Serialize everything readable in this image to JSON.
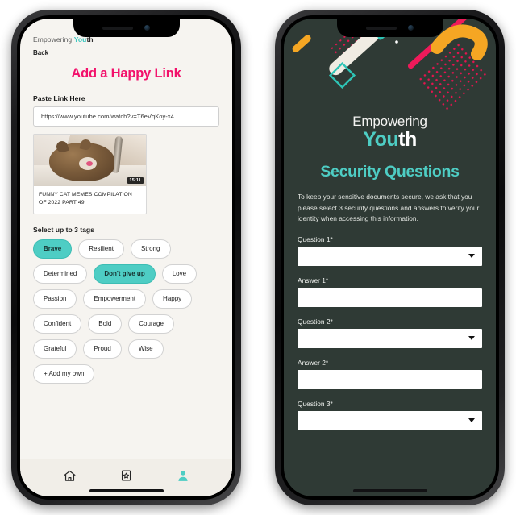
{
  "left_phone": {
    "brand": {
      "prefix": "Empowering ",
      "accent": "You",
      "dark": "th"
    },
    "back_label": "Back",
    "page_title": "Add a Happy Link",
    "link_field": {
      "label": "Paste Link Here",
      "value": "https://www.youtube.com/watch?v=T6eVqKoy-x4"
    },
    "preview": {
      "caption": "FUNNY CAT MEMES COMPILATION OF 2022 PART 49",
      "duration": "15:11"
    },
    "tags_label": "Select up to 3 tags",
    "tag_rows": [
      [
        {
          "label": "Brave",
          "selected": true
        },
        {
          "label": "Resilient",
          "selected": false
        },
        {
          "label": "Strong",
          "selected": false
        }
      ],
      [
        {
          "label": "Determined",
          "selected": false
        },
        {
          "label": "Don't give up",
          "selected": true
        },
        {
          "label": "Love",
          "selected": false
        }
      ],
      [
        {
          "label": "Passion",
          "selected": false
        },
        {
          "label": "Empowerment",
          "selected": false
        },
        {
          "label": "Happy",
          "selected": false
        }
      ],
      [
        {
          "label": "Confident",
          "selected": false
        },
        {
          "label": "Bold",
          "selected": false
        },
        {
          "label": "Courage",
          "selected": false
        }
      ],
      [
        {
          "label": "Grateful",
          "selected": false
        },
        {
          "label": "Proud",
          "selected": false
        },
        {
          "label": "Wise",
          "selected": false
        }
      ],
      [
        {
          "label": "+ Add my own",
          "selected": false
        }
      ]
    ],
    "tabbar": [
      {
        "icon": "home-icon",
        "active": false
      },
      {
        "icon": "star-box-icon",
        "active": false
      },
      {
        "icon": "profile-icon",
        "active": true
      }
    ]
  },
  "right_phone": {
    "brand": {
      "line1": "Empowering",
      "line2_accent": "You",
      "line2_white": "th"
    },
    "title": "Security Questions",
    "paragraph": "To keep your sensitive documents secure, we ask that you please select 3 security questions and answers to verify your identity when accessing this information.",
    "fields": [
      {
        "label": "Question 1*",
        "type": "select",
        "value": ""
      },
      {
        "label": "Answer 1*",
        "type": "text",
        "value": ""
      },
      {
        "label": "Question 2*",
        "type": "select",
        "value": ""
      },
      {
        "label": "Answer 2*",
        "type": "text",
        "value": ""
      },
      {
        "label": "Question 3*",
        "type": "select",
        "value": ""
      }
    ]
  },
  "colors": {
    "teal": "#4ecdc4",
    "pink": "#f2116b",
    "dark_green": "#2f3a35",
    "cream_bg": "#f6f4f0",
    "orange": "#f5a623",
    "crimson": "#e8134f"
  }
}
